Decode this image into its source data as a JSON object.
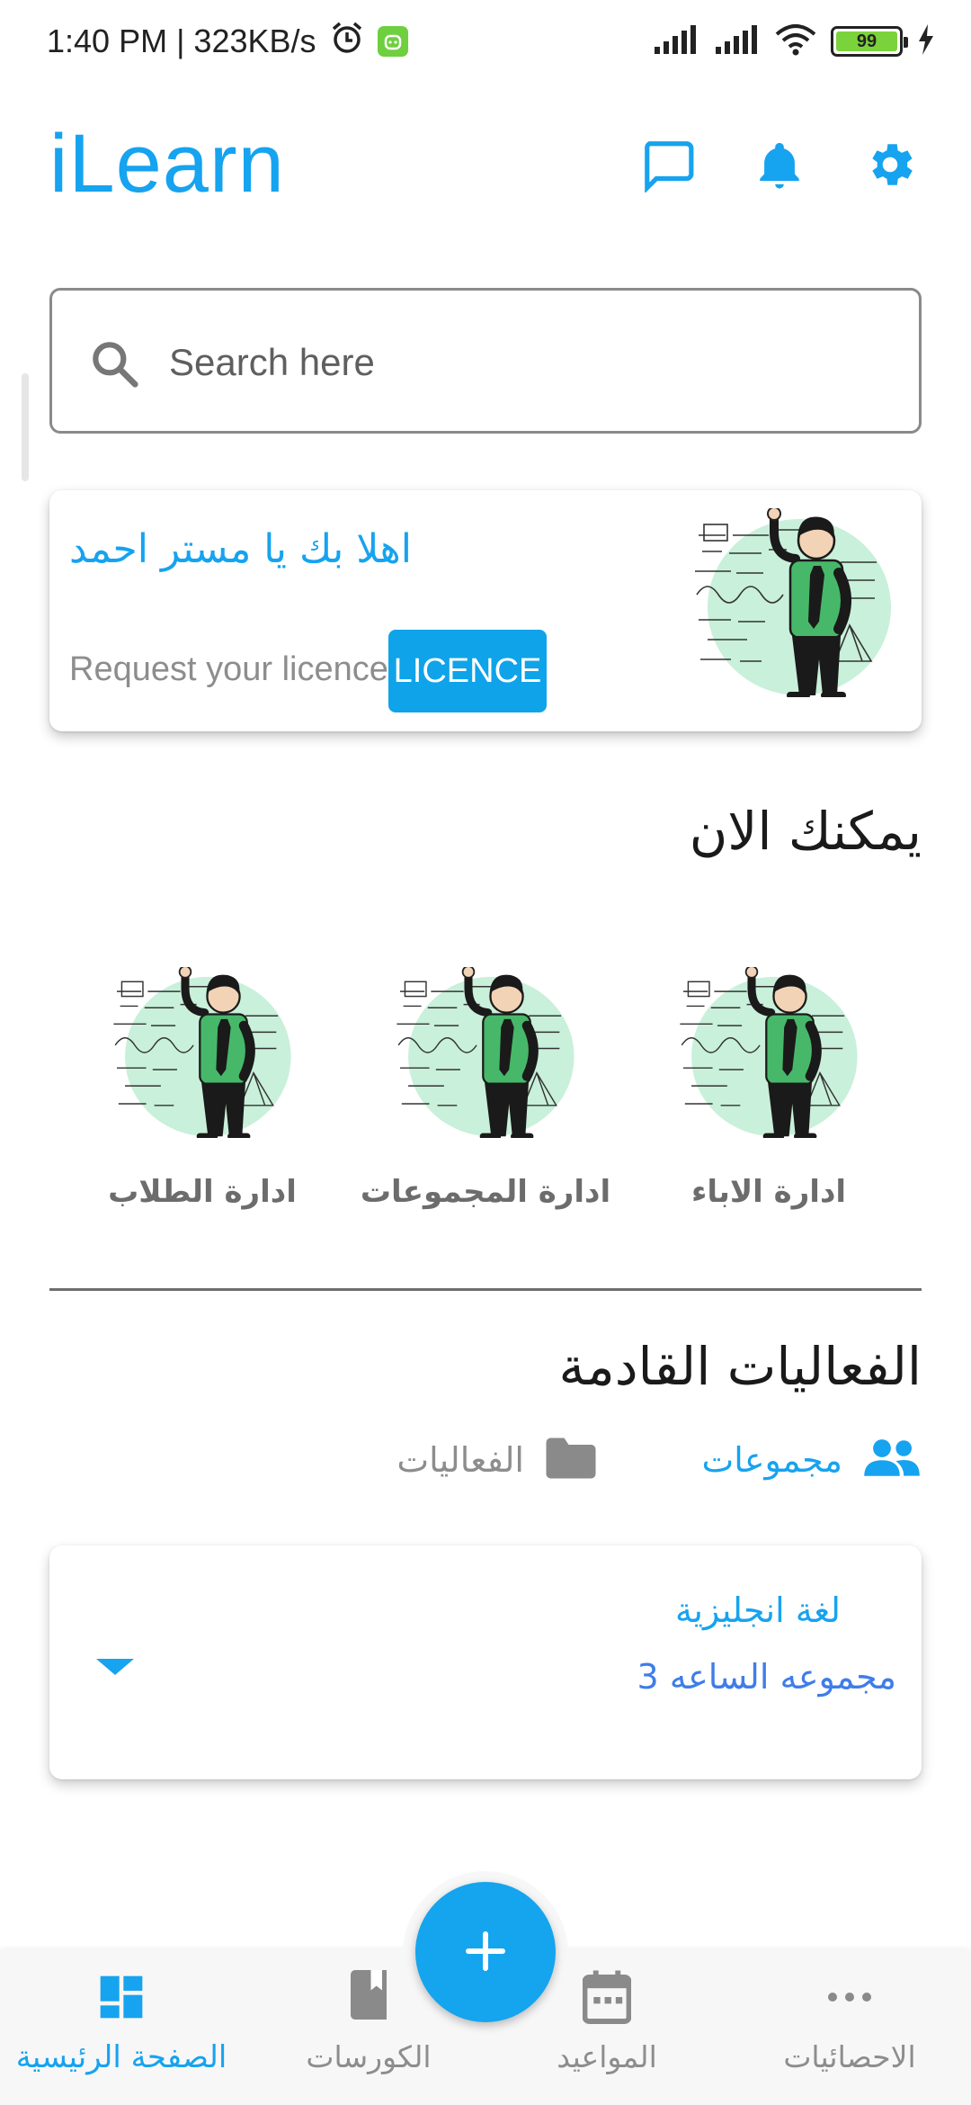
{
  "status_bar": {
    "time_speed": "1:40 PM | 323KB/s",
    "battery_level": "99"
  },
  "header": {
    "title": "iLearn"
  },
  "search": {
    "placeholder": "Search here"
  },
  "welcome_card": {
    "greeting": "اهلا بك يا مستر احمد",
    "licence_hint": "Request your licence",
    "licence_button": "LICENCE"
  },
  "features": {
    "heading": "يمكنك الان",
    "items": [
      {
        "label": "ادارة الطلاب"
      },
      {
        "label": "ادارة المجموعات"
      },
      {
        "label": "ادارة الاباء"
      }
    ]
  },
  "events": {
    "heading": "الفعاليات القادمة",
    "tabs": [
      {
        "label": "مجموعات",
        "icon": "groups-icon",
        "active": true
      },
      {
        "label": "الفعاليات",
        "icon": "folder-icon",
        "active": false
      }
    ],
    "card": {
      "title": "لغة انجليزية",
      "subtitle": "مجموعه الساعه 3"
    }
  },
  "bottom_nav": {
    "items": [
      {
        "label": "الصفحة الرئيسية",
        "icon": "dashboard-icon",
        "active": true
      },
      {
        "label": "الكورسات",
        "icon": "book-icon",
        "active": false
      },
      {
        "label": "المواعيد",
        "icon": "calendar-icon",
        "active": false
      },
      {
        "label": "الاحصائيات",
        "icon": "more-icon",
        "active": false
      }
    ]
  },
  "colors": {
    "accent": "#16a3ef",
    "inactive": "#8d8d8d",
    "subtitle": "#3f7de8"
  }
}
